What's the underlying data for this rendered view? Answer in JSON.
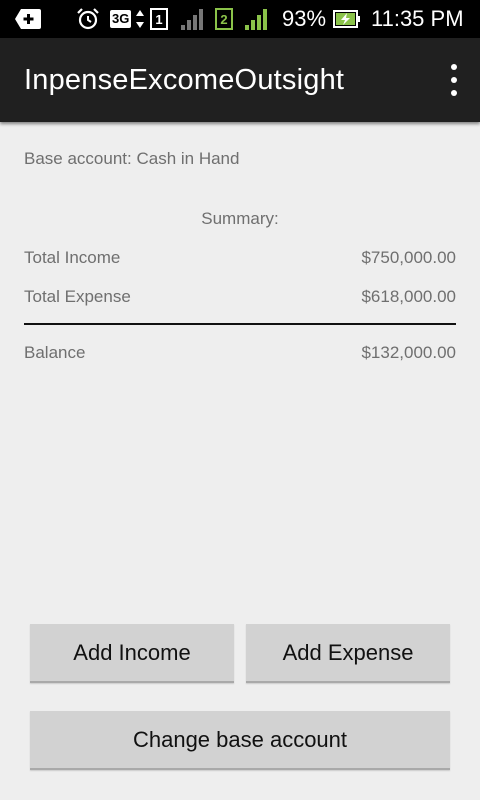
{
  "status_bar": {
    "network_type": "3G",
    "sim1_label": "1",
    "sim2_label": "2",
    "battery_percent": "93%",
    "time": "11:35 PM",
    "icons": [
      "notification-plus-icon",
      "alarm-icon",
      "data-arrows-icon",
      "sim1-icon",
      "signal-icon",
      "sim2-icon",
      "signal-icon",
      "battery-charging-icon"
    ],
    "sim2_color": "#8bc34a"
  },
  "action_bar": {
    "title": "InpenseExcomeOutsight",
    "overflow_icon": "overflow-menu-icon"
  },
  "main": {
    "base_account_text": "Base account: Cash in Hand",
    "summary_title": "Summary:",
    "rows": {
      "income": {
        "label": "Total Income",
        "value": "$750,000.00"
      },
      "expense": {
        "label": "Total Expense",
        "value": "$618,000.00"
      },
      "balance": {
        "label": "Balance",
        "value": "$132,000.00"
      }
    }
  },
  "buttons": {
    "add_income": "Add Income",
    "add_expense": "Add Expense",
    "change_base_account": "Change base account"
  }
}
